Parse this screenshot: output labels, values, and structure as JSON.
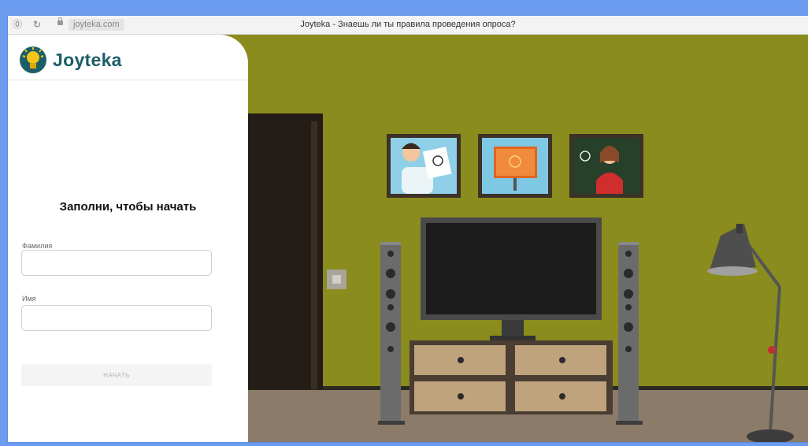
{
  "browser": {
    "url": "joyteka.com",
    "tab_title": "Joyteka - Знаешь ли ты правила проведения опроса?",
    "info_glyph": "⓪",
    "reload_glyph": "↻"
  },
  "logo": {
    "text": "Joyteka"
  },
  "form": {
    "title": "Заполни, чтобы начать",
    "surname_label": "Фамилия",
    "surname_value": "",
    "name_label": "Имя",
    "name_value": "",
    "start_label": "НАЧАТЬ"
  },
  "colors": {
    "wall": "#8a8c1d",
    "floor": "#8c7b68",
    "brand": "#1b5e68",
    "frame_border": "#6b9cf0"
  }
}
